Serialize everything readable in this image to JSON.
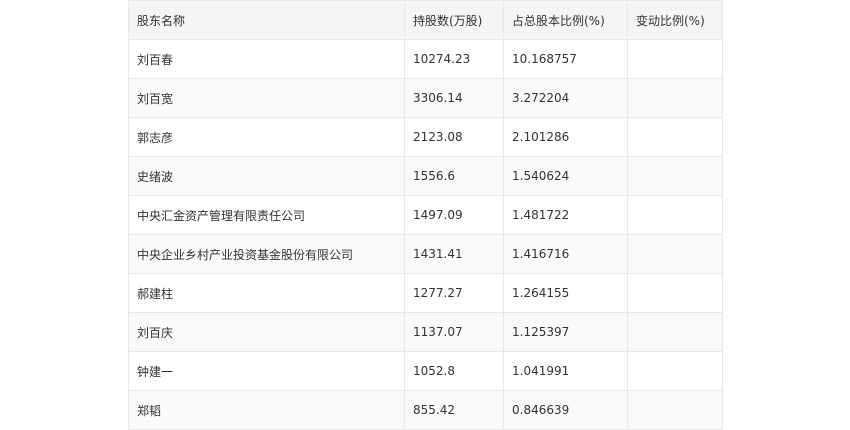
{
  "table": {
    "headers": [
      "股东名称",
      "持股数(万股)",
      "占总股本比例(%)",
      "变动比例(%)"
    ],
    "rows": [
      {
        "name": "刘百春",
        "shares": "10274.23",
        "ratio": "10.168757",
        "change": ""
      },
      {
        "name": "刘百宽",
        "shares": "3306.14",
        "ratio": "3.272204",
        "change": ""
      },
      {
        "name": "郭志彦",
        "shares": "2123.08",
        "ratio": "2.101286",
        "change": ""
      },
      {
        "name": "史绪波",
        "shares": "1556.6",
        "ratio": "1.540624",
        "change": ""
      },
      {
        "name": "中央汇金资产管理有限责任公司",
        "shares": "1497.09",
        "ratio": "1.481722",
        "change": ""
      },
      {
        "name": "中央企业乡村产业投资基金股份有限公司",
        "shares": "1431.41",
        "ratio": "1.416716",
        "change": ""
      },
      {
        "name": "郝建柱",
        "shares": "1277.27",
        "ratio": "1.264155",
        "change": ""
      },
      {
        "name": "刘百庆",
        "shares": "1137.07",
        "ratio": "1.125397",
        "change": ""
      },
      {
        "name": "钟建一",
        "shares": "1052.8",
        "ratio": "1.041991",
        "change": ""
      },
      {
        "name": "郑韬",
        "shares": "855.42",
        "ratio": "0.846639",
        "change": ""
      }
    ]
  }
}
